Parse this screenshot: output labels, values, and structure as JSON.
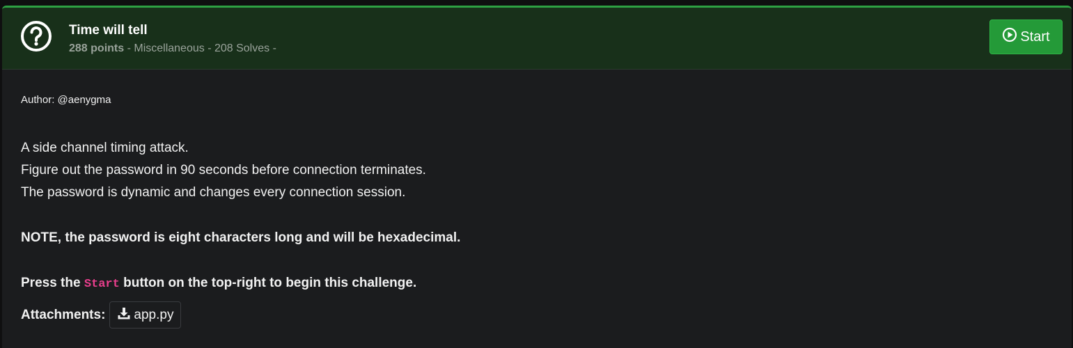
{
  "challenge": {
    "title": "Time will tell",
    "points": "288 points",
    "meta_rest": " - Miscellaneous - 208 Solves -",
    "start_label": "Start",
    "icon": "question-circle-icon"
  },
  "description": {
    "author": "Author: @aenygma",
    "lines": [
      "A side channel timing attack.",
      "Figure out the password in 90 seconds before connection terminates.",
      "The password is dynamic and changes every connection session."
    ],
    "note": "NOTE, the password is eight characters long and will be hexadecimal.",
    "press_before": "Press the ",
    "press_code": "Start",
    "press_after": " button on the top-right to begin this challenge."
  },
  "attachments": {
    "label": "Attachments:",
    "files": [
      {
        "name": "app.py",
        "icon": "download-icon"
      }
    ]
  },
  "colors": {
    "accent_green": "#249a38",
    "header_bg": "#18301a",
    "code_pink": "#e83e8c"
  }
}
